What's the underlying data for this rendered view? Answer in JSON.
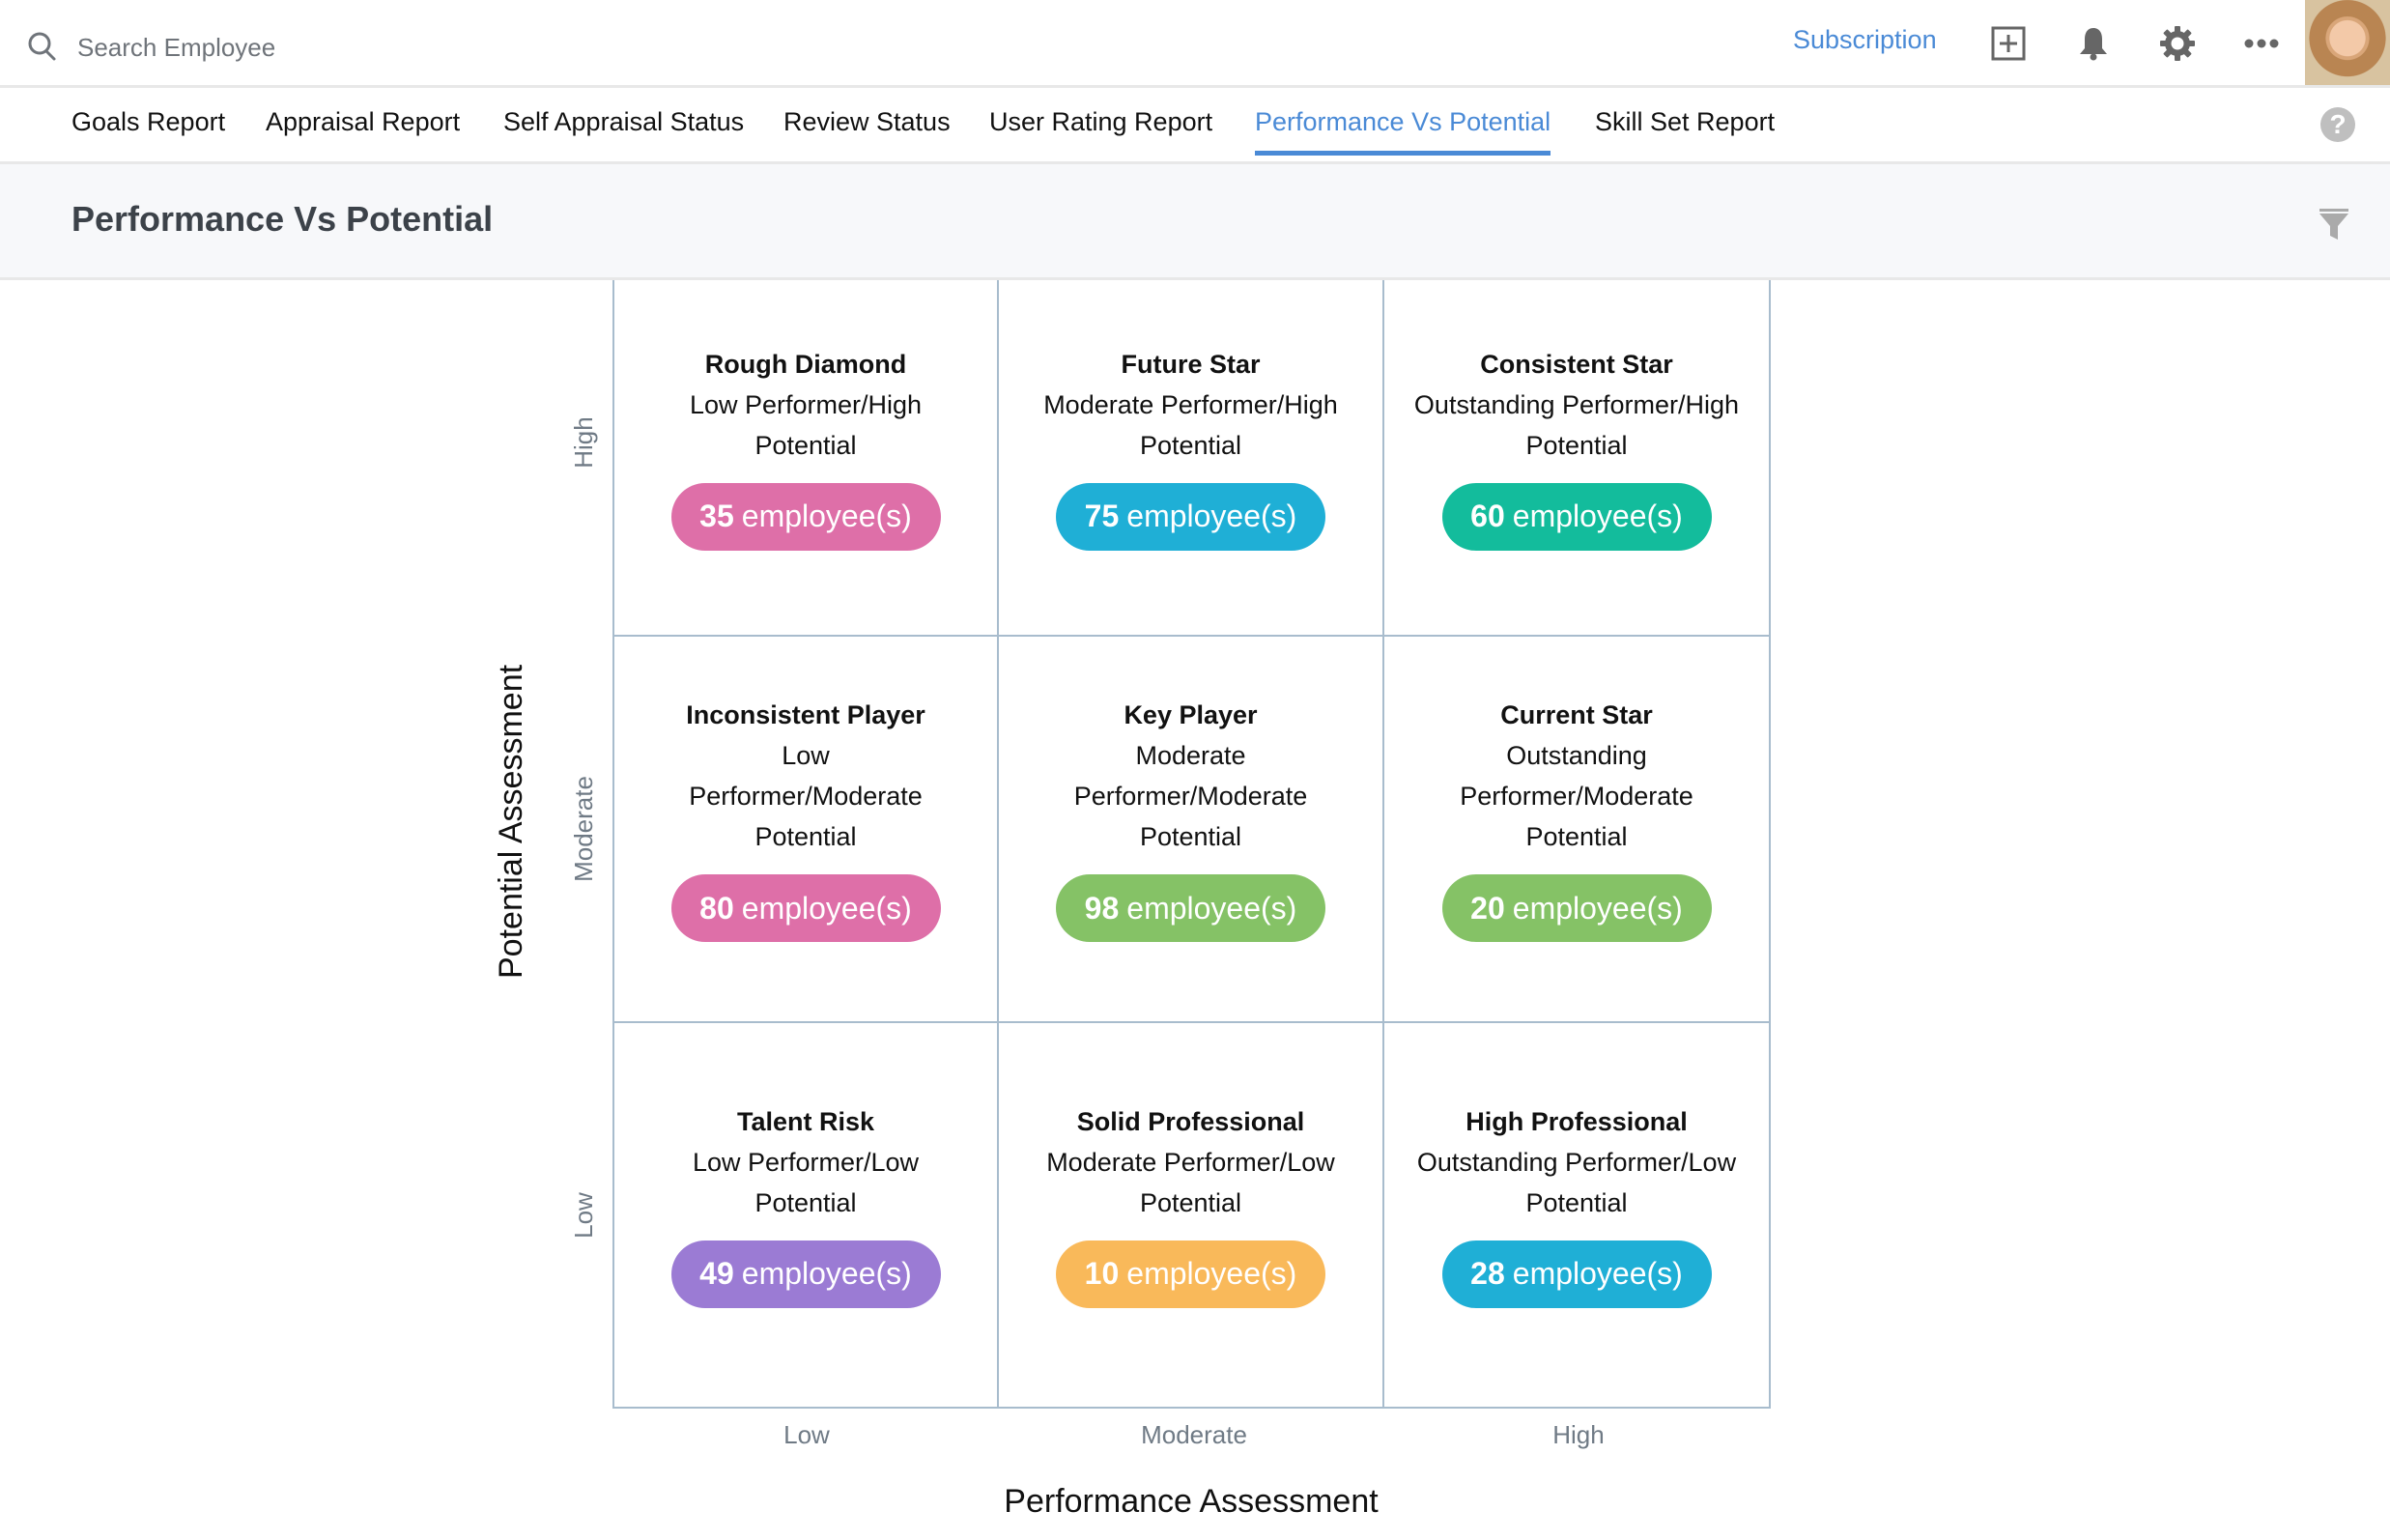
{
  "header": {
    "search_placeholder": "Search Employee",
    "subscription_label": "Subscription",
    "icons": [
      "search-icon",
      "add-icon",
      "bell-icon",
      "gear-icon",
      "more-icon",
      "avatar"
    ]
  },
  "tabs": [
    {
      "label": "Goals Report",
      "active": false
    },
    {
      "label": "Appraisal Report",
      "active": false
    },
    {
      "label": "Self Appraisal Status",
      "active": false
    },
    {
      "label": "Review Status",
      "active": false
    },
    {
      "label": "User Rating Report",
      "active": false
    },
    {
      "label": "Performance Vs Potential",
      "active": true
    },
    {
      "label": "Skill Set Report",
      "active": false
    }
  ],
  "help_label": "?",
  "page": {
    "title": "Performance Vs Potential"
  },
  "colors": {
    "accent": "#4a8ad6",
    "pink": "#de6fa8",
    "blue": "#1fafd6",
    "teal": "#13bc9c",
    "green": "#85c266",
    "purple": "#9b7bd4",
    "orange": "#f9b95a"
  },
  "matrix": {
    "y_axis_title": "Potential Assessment",
    "x_axis_title": "Performance Assessment",
    "y_labels": [
      "High",
      "Moderate",
      "Low"
    ],
    "x_labels": [
      "Low",
      "Moderate",
      "High"
    ],
    "count_suffix": "employee(s)",
    "rows": [
      [
        {
          "title": "Rough Diamond",
          "desc": "Low Performer/High Potential",
          "count": "35",
          "color": "#de6fa8"
        },
        {
          "title": "Future Star",
          "desc": "Moderate Performer/High Potential",
          "count": "75",
          "color": "#1fafd6"
        },
        {
          "title": "Consistent Star",
          "desc": "Outstanding Performer/High Potential",
          "count": "60",
          "color": "#13bc9c"
        }
      ],
      [
        {
          "title": "Inconsistent Player",
          "desc": "Low Performer/Moderate Potential",
          "count": "80",
          "color": "#de6fa8"
        },
        {
          "title": "Key Player",
          "desc": "Moderate Performer/Moderate Potential",
          "count": "98",
          "color": "#85c266"
        },
        {
          "title": "Current Star",
          "desc": "Outstanding Performer/Moderate Potential",
          "count": "20",
          "color": "#85c266"
        }
      ],
      [
        {
          "title": "Talent Risk",
          "desc": "Low Performer/Low Potential",
          "count": "49",
          "color": "#9b7bd4"
        },
        {
          "title": "Solid Professional",
          "desc": "Moderate Performer/Low Potential",
          "count": "10",
          "color": "#f9b95a"
        },
        {
          "title": "High Professional",
          "desc": "Outstanding Performer/Low Potential",
          "count": "28",
          "color": "#1fafd6"
        }
      ]
    ]
  }
}
